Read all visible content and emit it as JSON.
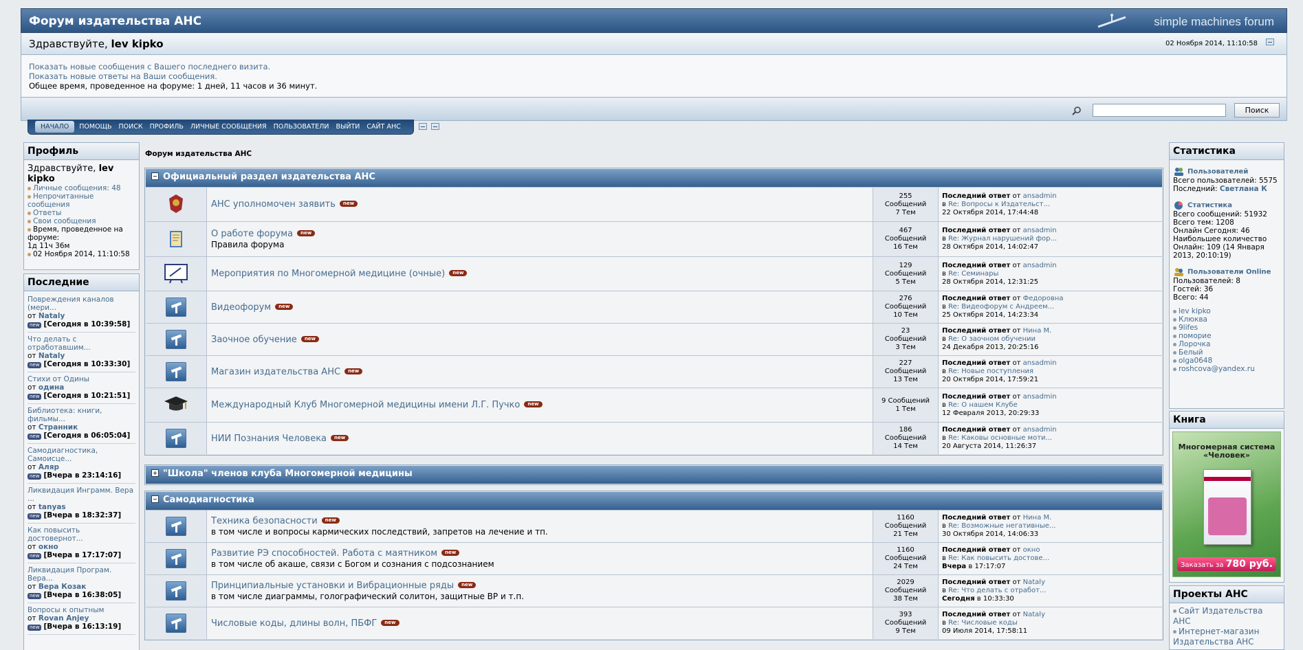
{
  "header": {
    "forum_title": "Форум издательства АНС",
    "brand": "simple machines forum",
    "greeting_prefix": "Здравствуйте,",
    "username": "lev kipko",
    "datetime": "02 Ноября 2014, 11:10:58"
  },
  "info": {
    "link_new_posts": "Показать новые сообщения с Вашего последнего визита.",
    "link_new_replies": "Показать новые ответы на Ваши сообщения.",
    "online_time": "Общее время, проведенное на форуме: 1 дней, 11 часов и 36 минут."
  },
  "search": {
    "button": "Поиск",
    "value": ""
  },
  "menu": [
    "НАЧАЛО",
    "ПОМОЩЬ",
    "ПОИСК",
    "ПРОФИЛЬ",
    "ЛИЧНЫЕ СООБЩЕНИЯ",
    "ПОЛЬЗОВАТЕЛИ",
    "ВЫЙТИ",
    "САЙТ АНС"
  ],
  "profile": {
    "title": "Профиль",
    "greet_prefix": "Здравствуйте,",
    "username": "lev kipko",
    "pm": "Личные сообщения: 48",
    "unread": "Непрочитанные сообщения",
    "replies": "Ответы",
    "own_posts": "Свои сообщения",
    "time_label": "Время, проведенное на форуме:",
    "time_value": "1д 11ч 36м",
    "date": "02 Ноября 2014, 11:10:58"
  },
  "recent": {
    "title": "Последние",
    "from": "от",
    "items": [
      {
        "topic": "Повреждения каналов (мери...",
        "author": "Nataly",
        "time": "[Сегодня в 10:39:58]"
      },
      {
        "topic": "Что делать с отработавшим...",
        "author": "Nataly",
        "time": "[Сегодня в 10:33:30]"
      },
      {
        "topic": "Стихи от Одины",
        "author": "одина",
        "time": "[Сегодня в 10:21:51]"
      },
      {
        "topic": "Библиотека: книги, фильмы...",
        "author": "Странник",
        "time": "[Сегодня в 06:05:04]"
      },
      {
        "topic": "Самодиагностика, Самоисце...",
        "author": "Аляр",
        "time": "[Вчера в 23:14:16]"
      },
      {
        "topic": "Ликвидация Инграмм. Вера ...",
        "author": "tanyas",
        "time": "[Вчера в 18:32:37]"
      },
      {
        "topic": "Как повысить достовернот...",
        "author": "окно",
        "time": "[Вчера в 17:17:07]"
      },
      {
        "topic": "Ликвидация Програм. Вера...",
        "author": "Вера Козак",
        "time": "[Вчера в 16:38:05]"
      },
      {
        "topic": "Вопросы к опытным",
        "author": "Rovan Anjey",
        "time": "[Вчера в 16:13:19]"
      }
    ]
  },
  "breadcrumb": "Форум издательства АНС",
  "categories": [
    {
      "title": "Официальный раздел издательства АНС",
      "boards": [
        {
          "name": "АНС уполномочен заявить",
          "desc": "",
          "posts": "255 Сообщений",
          "topics": "7 Тем",
          "lp_label": "Последний ответ",
          "lp_by": "от",
          "lp_author": "ansadmin",
          "lp_in": "в",
          "lp_topic": "Re: Вопросы к Издательст...",
          "lp_time": "22 Октября 2014, 17:44:48"
        },
        {
          "name": "О работе форума",
          "desc": "Правила форума",
          "posts": "467 Сообщений",
          "topics": "16 Тем",
          "lp_label": "Последний ответ",
          "lp_by": "от",
          "lp_author": "ansadmin",
          "lp_in": "в",
          "lp_topic": "Re: Журнал нарушений фор...",
          "lp_time": "28 Октября 2014, 14:02:47"
        },
        {
          "name": "Мероприятия по Многомерной медицине (очные)",
          "desc": "",
          "posts": "129 Сообщений",
          "topics": "5 Тем",
          "lp_label": "Последний ответ",
          "lp_by": "от",
          "lp_author": "ansadmin",
          "lp_in": "в",
          "lp_topic": "Re: Семинары",
          "lp_time": "28 Октября 2014, 12:31:25"
        },
        {
          "name": "Видеофорум",
          "desc": "",
          "posts": "276 Сообщений",
          "topics": "10 Тем",
          "lp_label": "Последний ответ",
          "lp_by": "от",
          "lp_author": "Федоровна",
          "lp_in": "в",
          "lp_topic": "Re: Видеофорум с Андреем...",
          "lp_time": "25 Октября 2014, 14:23:34"
        },
        {
          "name": "Заочное обучение",
          "desc": "",
          "posts": "23 Сообщений",
          "topics": "3 Тем",
          "lp_label": "Последний ответ",
          "lp_by": "от",
          "lp_author": "Нина М.",
          "lp_in": "в",
          "lp_topic": "Re: О заочном обучении",
          "lp_time": "24 Декабря 2013, 20:25:16"
        },
        {
          "name": "Магазин издательства АНС",
          "desc": "",
          "posts": "227 Сообщений",
          "topics": "13 Тем",
          "lp_label": "Последний ответ",
          "lp_by": "от",
          "lp_author": "ansadmin",
          "lp_in": "в",
          "lp_topic": "Re: Новые поступления",
          "lp_time": "20 Октября 2014, 17:59:21"
        },
        {
          "name": "Международный Клуб Многомерной медицины имени Л.Г. Пучко",
          "desc": "",
          "posts": "9 Сообщений",
          "topics": "1 Тем",
          "lp_label": "Последний ответ",
          "lp_by": "от",
          "lp_author": "ansadmin",
          "lp_in": "в",
          "lp_topic": "Re: О нашем Клубе",
          "lp_time": "12 Февраля 2013, 20:29:33"
        },
        {
          "name": "НИИ Познания Человека",
          "desc": "",
          "posts": "186 Сообщений",
          "topics": "14 Тем",
          "lp_label": "Последний ответ",
          "lp_by": "от",
          "lp_author": "ansadmin",
          "lp_in": "в",
          "lp_topic": "Re: Каковы основные моти...",
          "lp_time": "20 Августа 2014, 11:26:37"
        }
      ]
    },
    {
      "title": "\"Школа\" членов клуба Многомерной медицины",
      "boards": []
    },
    {
      "title": "Самодиагностика",
      "boards": [
        {
          "name": "Техника безопасности",
          "desc": "в том числе и вопросы кармических последствий, запретов на лечение и тп.",
          "posts": "1160 Сообщений",
          "topics": "21 Тем",
          "lp_label": "Последний ответ",
          "lp_by": "от",
          "lp_author": "Нина М.",
          "lp_in": "в",
          "lp_topic": "Re: Возможные негативные...",
          "lp_time": "30 Октября 2014, 14:06:33"
        },
        {
          "name": "Развитие РЭ способностей. Работа с маятником",
          "desc": "в том числе об акаше, связи с Богом и сознания с подсознанием",
          "posts": "1160 Сообщений",
          "topics": "24 Тем",
          "lp_label": "Последний ответ",
          "lp_by": "от",
          "lp_author": "окно",
          "lp_in": "в",
          "lp_topic": "Re: Как повысить достове...",
          "lp_time": "Вчера в 17:17:07"
        },
        {
          "name": "Принципиальные установки и Вибрационные ряды",
          "desc": "в том числе диаграммы, голографический солитон, защитные ВР и т.п.",
          "posts": "2029 Сообщений",
          "topics": "38 Тем",
          "lp_label": "Последний ответ",
          "lp_by": "от",
          "lp_author": "Nataly",
          "lp_in": "в",
          "lp_topic": "Re: Что делать с отработ...",
          "lp_time": "Сегодня в 10:33:30"
        },
        {
          "name": "Числовые коды, длины волн, ПБФГ",
          "desc": "",
          "posts": "393 Сообщений",
          "topics": "9 Тем",
          "lp_label": "Последний ответ",
          "lp_by": "от",
          "lp_author": "Nataly",
          "lp_in": "в",
          "lp_topic": "Re: Числовые коды",
          "lp_time": "09 Июля 2014, 17:58:11"
        }
      ]
    }
  ],
  "stats": {
    "title": "Статистика",
    "users_head": "Пользователей",
    "total_users": "Всего пользователей: 5575",
    "latest_label": "Последний:",
    "latest_user": "Светлана К",
    "stats_head": "Статистика",
    "total_posts": "Всего сообщений: 51932",
    "total_topics": "Всего тем: 1208",
    "online_today": "Онлайн Сегодня: 46",
    "most_online": "Наибольшее количество Онлайн: 109 (14 Января 2013, 20:10:19)",
    "online_head": "Пользователи Online",
    "online_users": "Пользователей: 8",
    "guests": "Гостей: 36",
    "total": "Всего: 44",
    "names": [
      "lev kipko",
      "Клюква",
      "9lifes",
      "поморие",
      "Лорочка",
      "Белый",
      "olga0648",
      "roshcova@yandex.ru"
    ]
  },
  "book": {
    "title": "Книга",
    "cover_title": "Многомерная система «Человек»",
    "order_label": "Заказать за",
    "price": "780 руб."
  },
  "projects": {
    "title": "Проекты АНС",
    "items": [
      "Сайт Издательства АНС",
      "Интернет-магазин Издательства АНС"
    ]
  },
  "new_badge": "new"
}
